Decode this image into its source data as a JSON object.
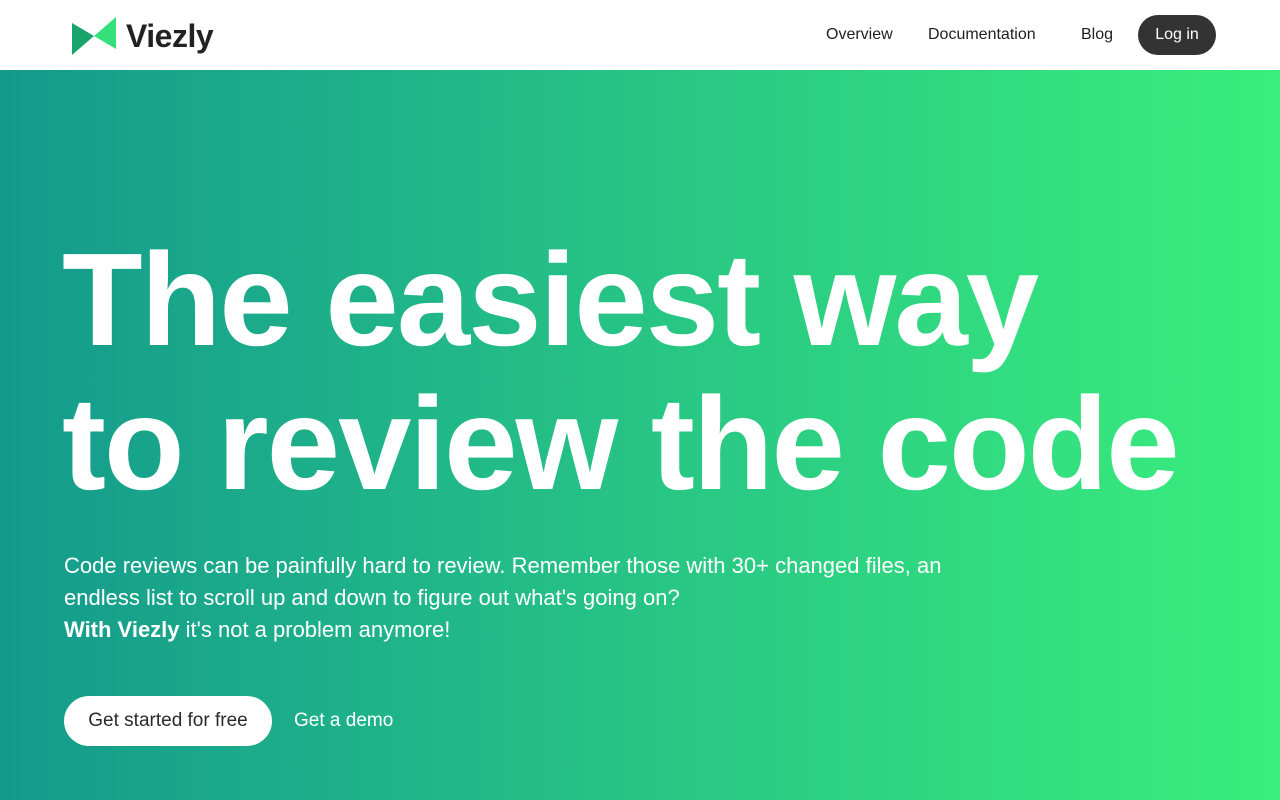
{
  "brand": {
    "name": "Viezly",
    "logo_icon": "bowtie-logo-icon",
    "logo_color_light": "#33e07a",
    "logo_color_dark": "#1aa36a"
  },
  "nav": {
    "overview": "Overview",
    "documentation": "Documentation",
    "blog": "Blog",
    "login": "Log in"
  },
  "hero": {
    "headline_line1": "The easiest way",
    "headline_line2": "to review the code",
    "description_line1": "Code reviews can be painfully hard to review. Remember those with 30+ changed files, an",
    "description_line2": "endless list to scroll up and down to figure out what's going on?",
    "description_bold": "With Viezly",
    "description_tail": " it's not a problem anymore!",
    "cta_primary": "Get started for free",
    "cta_secondary": "Get a demo"
  },
  "colors": {
    "gradient_start": "#149a8c",
    "gradient_end": "#3aee7c",
    "login_bg": "#333333"
  }
}
